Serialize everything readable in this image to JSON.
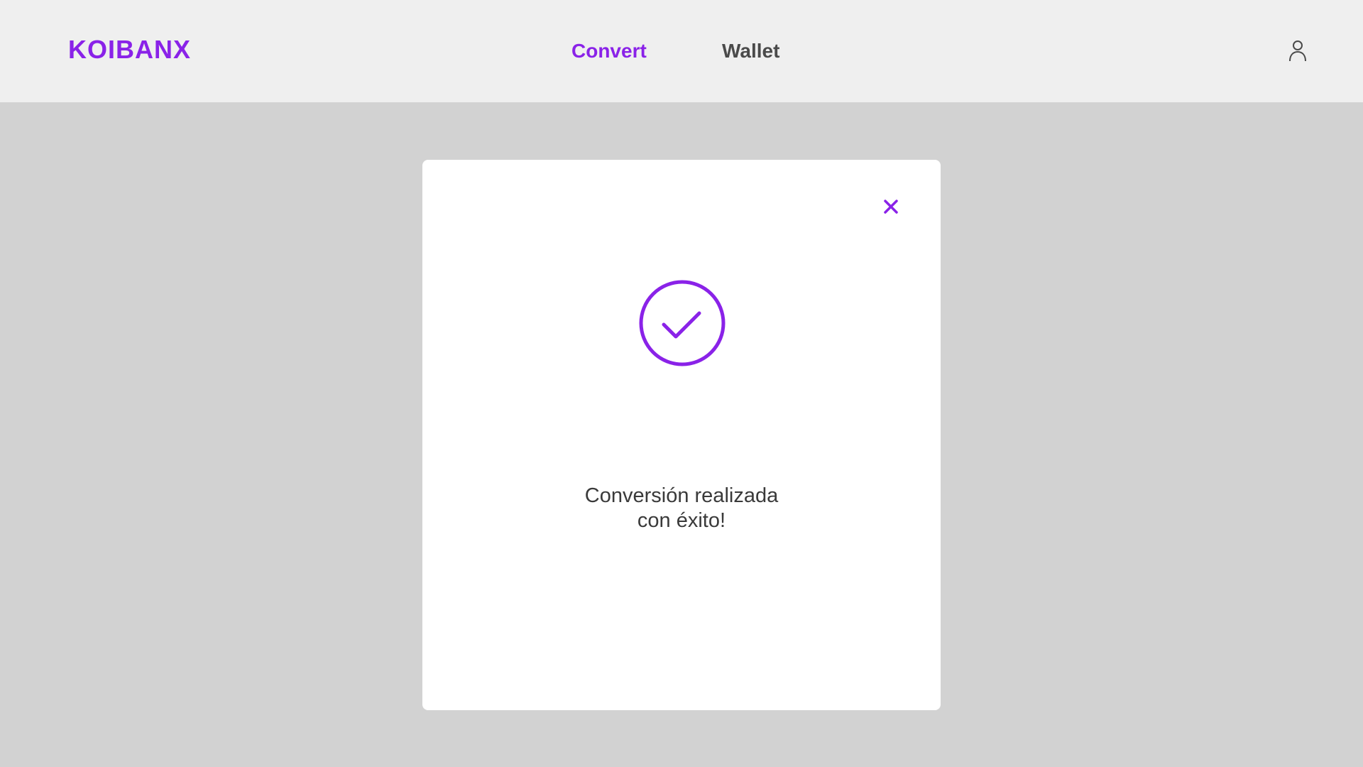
{
  "app": {
    "brand": "KOIBANX"
  },
  "header": {
    "nav": [
      {
        "label": "Convert",
        "active": true
      },
      {
        "label": "Wallet",
        "active": false
      }
    ],
    "user_icon": "user-icon"
  },
  "modal": {
    "status_icon": "check-circle-icon",
    "close_icon": "close-icon",
    "message_line1": "Conversión realizada",
    "message_line2": "con éxito!"
  },
  "colors": {
    "accent": "#8a22e8",
    "header_bg": "#efefef",
    "page_bg": "#d2d2d2",
    "nav_inactive": "#4a4a4a",
    "modal_bg": "#ffffff"
  }
}
